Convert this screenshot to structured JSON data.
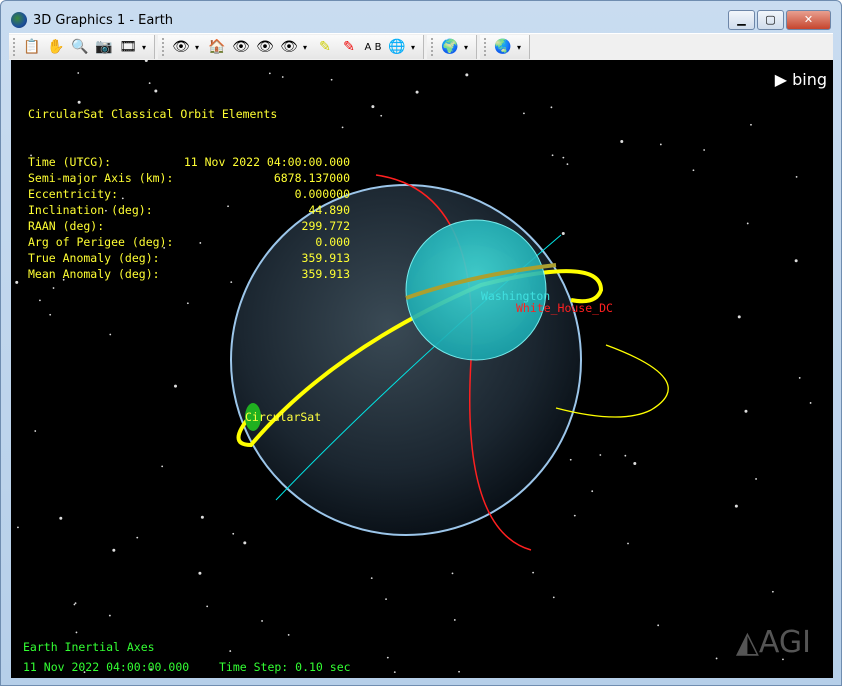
{
  "window": {
    "title": "3D Graphics 1 - Earth",
    "minimize": "▁",
    "maximize": "▢",
    "close": "✕"
  },
  "toolbar": {
    "groups": [
      [
        "properties-icon",
        "pan-hand-icon",
        "zoom-in-icon",
        "snapshot-icon",
        "record-movie-icon"
      ],
      [
        "view-from-icon",
        "home-view-icon",
        "orient-view-icon",
        "view-down-icon"
      ],
      [
        "view-object-icon",
        "highlighter-icon",
        "pen-icon",
        "measure-ruler-icon",
        "globe-manager-icon"
      ],
      [
        "globe-data-icon"
      ],
      [
        "earth-download-icon"
      ]
    ]
  },
  "overlay": {
    "title": "CircularSat Classical Orbit Elements",
    "rows": [
      {
        "label": "Time (UTCG):",
        "value": "11 Nov 2022 04:00:00.000"
      },
      {
        "label": "Semi-major Axis (km):",
        "value": "6878.137000"
      },
      {
        "label": "Eccentricity:",
        "value": "0.000000"
      },
      {
        "label": "Inclination (deg):",
        "value": "44.890"
      },
      {
        "label": "RAAN (deg):",
        "value": "299.772"
      },
      {
        "label": "Arg of Perigee (deg):",
        "value": "0.000"
      },
      {
        "label": "True Anomaly (deg):",
        "value": "359.913"
      },
      {
        "label": "Mean Anomaly (deg):",
        "value": "359.913"
      }
    ]
  },
  "scene": {
    "satellite_label": "CircularSat",
    "place_label": "Washington",
    "facility_label": "White_House_DC"
  },
  "status": {
    "axes": "Earth Inertial Axes",
    "time": "11 Nov 2022 04:00:00.000",
    "timestep": "Time Step: 0.10 sec"
  },
  "logos": {
    "bing": "bing",
    "agi": "AGI"
  },
  "colors": {
    "orbit": "#ffff00",
    "sensor": "#00e5e5",
    "red_orbit": "#ff2020",
    "text": "#ffff33",
    "status": "#33ff33"
  }
}
